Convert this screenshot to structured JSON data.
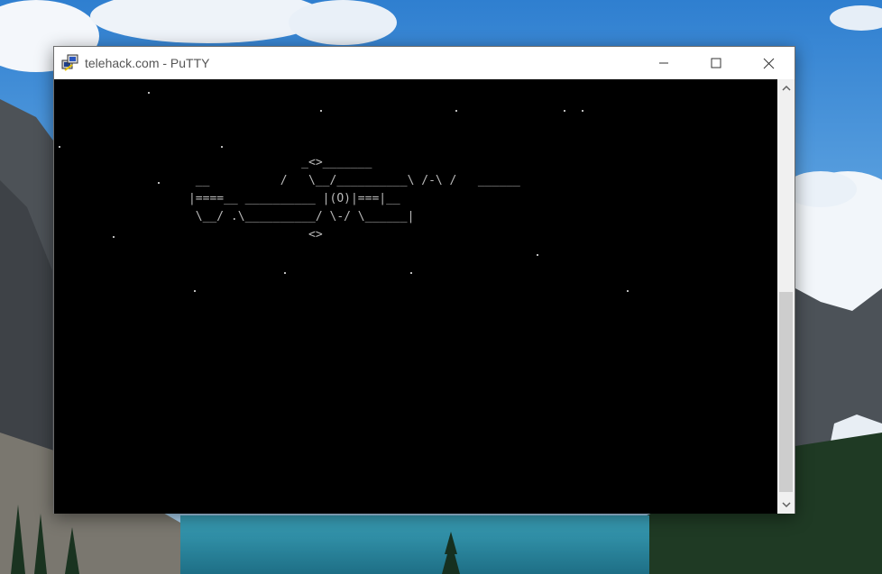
{
  "window": {
    "title": "telehack.com - PuTTY",
    "app_icon": "putty-icon",
    "controls": {
      "minimize_icon": "minimize-icon",
      "maximize_icon": "maximize-icon",
      "close_icon": "close-icon"
    }
  },
  "terminal": {
    "ascii_art": [
      "                      _<>_______",
      "       __          /   \\__/__________\\ /-\\ /   ______",
      "      |====__ __________ |(O)|===|__",
      "       \\__/ .\\__________/ \\-/ \\______|",
      "                       <>"
    ]
  },
  "scrollbar": {
    "up_icon": "scroll-up-arrow-icon",
    "down_icon": "scroll-down-arrow-icon"
  },
  "colors": {
    "terminal_bg": "#000000",
    "terminal_fg": "#bbbbbb",
    "titlebar_bg": "#ffffff",
    "scrollbar_bg": "#f0f0f0"
  }
}
